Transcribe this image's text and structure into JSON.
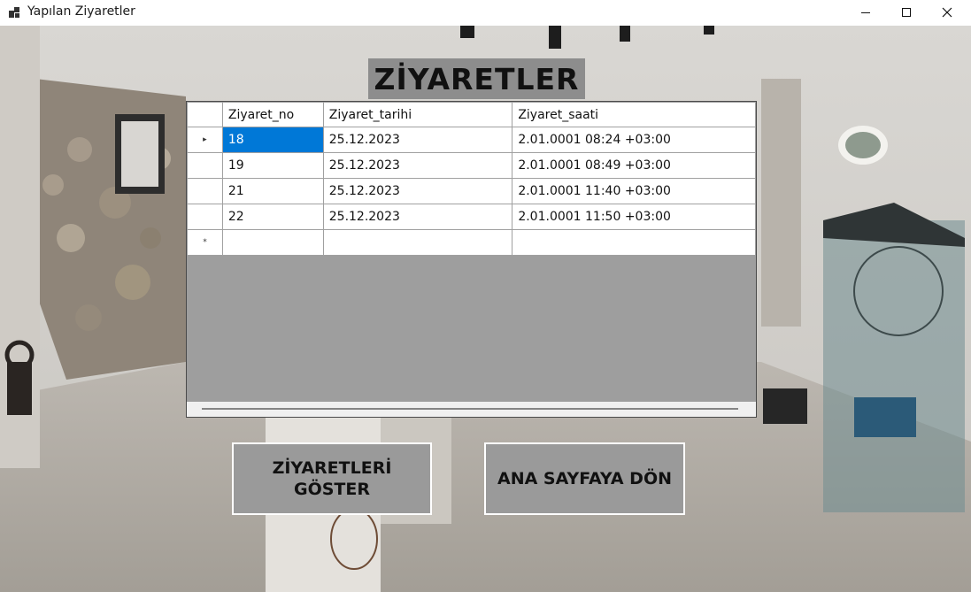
{
  "window": {
    "title": "Yapılan Ziyaretler",
    "icon": "app-icon",
    "controls": [
      "minimize-icon",
      "maximize-icon",
      "close-icon"
    ]
  },
  "heading": "ZİYARETLER",
  "grid": {
    "columns": [
      "Ziyaret_no",
      "Ziyaret_tarihi",
      "Ziyaret_saati"
    ],
    "rows": [
      [
        "18",
        "25.12.2023",
        "2.01.0001 08:24 +03:00"
      ],
      [
        "19",
        "25.12.2023",
        "2.01.0001 08:49 +03:00"
      ],
      [
        "21",
        "25.12.2023",
        "2.01.0001 11:40 +03:00"
      ],
      [
        "22",
        "25.12.2023",
        "2.01.0001 11:50 +03:00"
      ]
    ],
    "current_row_marker": "▸",
    "new_row_marker": "*"
  },
  "buttons": {
    "show_visits": "ZİYARETLERİ GÖSTER",
    "back_home": "ANA SAYFAYA DÖN"
  },
  "colors": {
    "selection": "#0078d7",
    "button_bg": "#9a9a9a",
    "grid_empty_bg": "#9e9e9e"
  }
}
